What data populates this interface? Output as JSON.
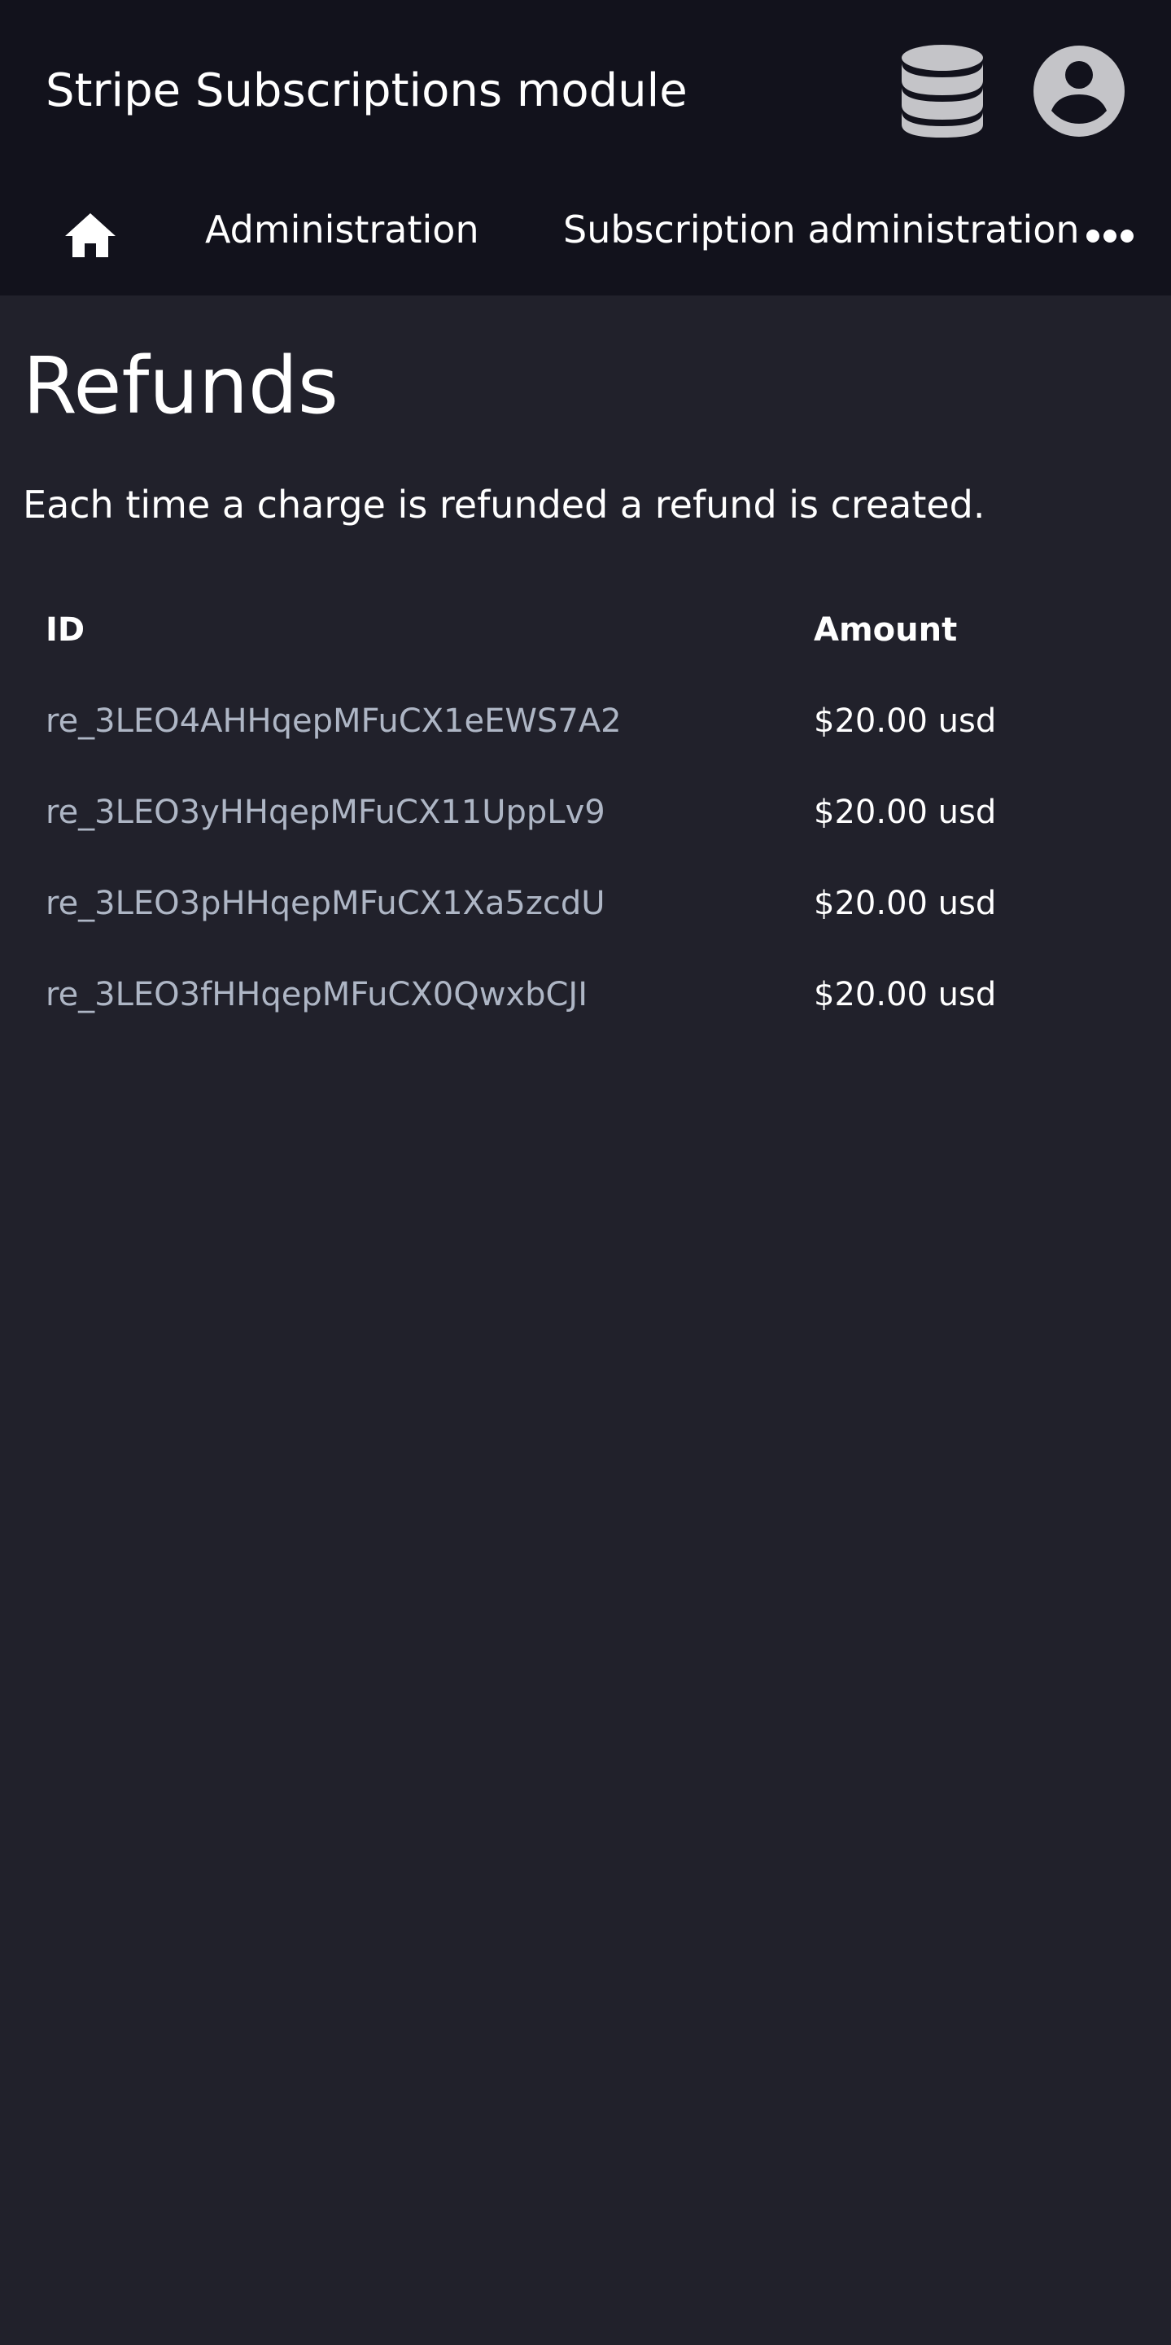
{
  "app": {
    "title": "Stripe Subscriptions module"
  },
  "icons": {
    "database": "database-icon",
    "account": "account-circle-icon",
    "home": "home-icon",
    "more": "more-horizontal-icon"
  },
  "nav": {
    "items": [
      {
        "label": "Administration"
      },
      {
        "label": "Subscription administration"
      }
    ]
  },
  "page": {
    "title": "Refunds",
    "description": "Each time a charge is refunded a refund is created."
  },
  "table": {
    "columns": [
      "ID",
      "Amount"
    ],
    "rows": [
      {
        "id": "re_3LEO4AHHqepMFuCX1eEWS7A2",
        "amount": "$20.00 usd"
      },
      {
        "id": "re_3LEO3yHHqepMFuCX11UppLv9",
        "amount": "$20.00 usd"
      },
      {
        "id": "re_3LEO3pHHqepMFuCX1Xa5zcdU",
        "amount": "$20.00 usd"
      },
      {
        "id": "re_3LEO3fHHqepMFuCX0QwxbCJI",
        "amount": "$20.00 usd"
      }
    ]
  },
  "colors": {
    "topbar_bg": "#12121c",
    "page_bg": "#21212b",
    "text": "#ffffff",
    "link_text": "#aeb6c5",
    "icon_fill": "#c4c4c8"
  }
}
